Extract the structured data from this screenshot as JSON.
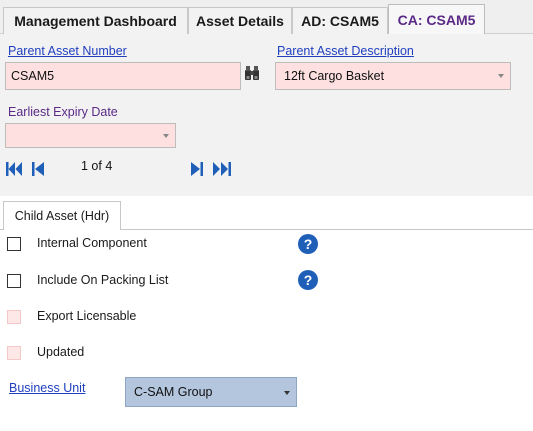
{
  "tabs": [
    {
      "label": "Management Dashboard",
      "active": false
    },
    {
      "label": "Asset Details",
      "active": false
    },
    {
      "label": "AD: CSAM5",
      "active": false
    },
    {
      "label": "CA: CSAM5",
      "active": true
    }
  ],
  "header": {
    "parent_asset_number_label": "Parent Asset Number",
    "parent_asset_number_value": "CSAM5",
    "parent_asset_description_label": "Parent Asset Description",
    "parent_asset_description_value": "12ft Cargo Basket",
    "earliest_expiry_label": "Earliest Expiry Date",
    "earliest_expiry_value": ""
  },
  "navigator": {
    "position_text": "1 of 4"
  },
  "subtab": {
    "label": "Child Asset (Hdr)"
  },
  "checks": [
    {
      "label": "Internal Component",
      "checked": false,
      "has_help": true
    },
    {
      "label": "Include On Packing List",
      "checked": false,
      "has_help": true
    },
    {
      "label": "Export Licensable",
      "checked": false,
      "has_help": false
    },
    {
      "label": "Updated",
      "checked": false,
      "has_help": false
    }
  ],
  "business_unit": {
    "label": "Business Unit",
    "value": "C-SAM Group"
  },
  "help_glyph": "?",
  "colors": {
    "required_field": "#fde0df",
    "link": "#1f3fbf",
    "active_tab_text": "#5b2a86",
    "nav_icon": "#1f5fb8",
    "business_unit_field": "#b3c6dd"
  }
}
